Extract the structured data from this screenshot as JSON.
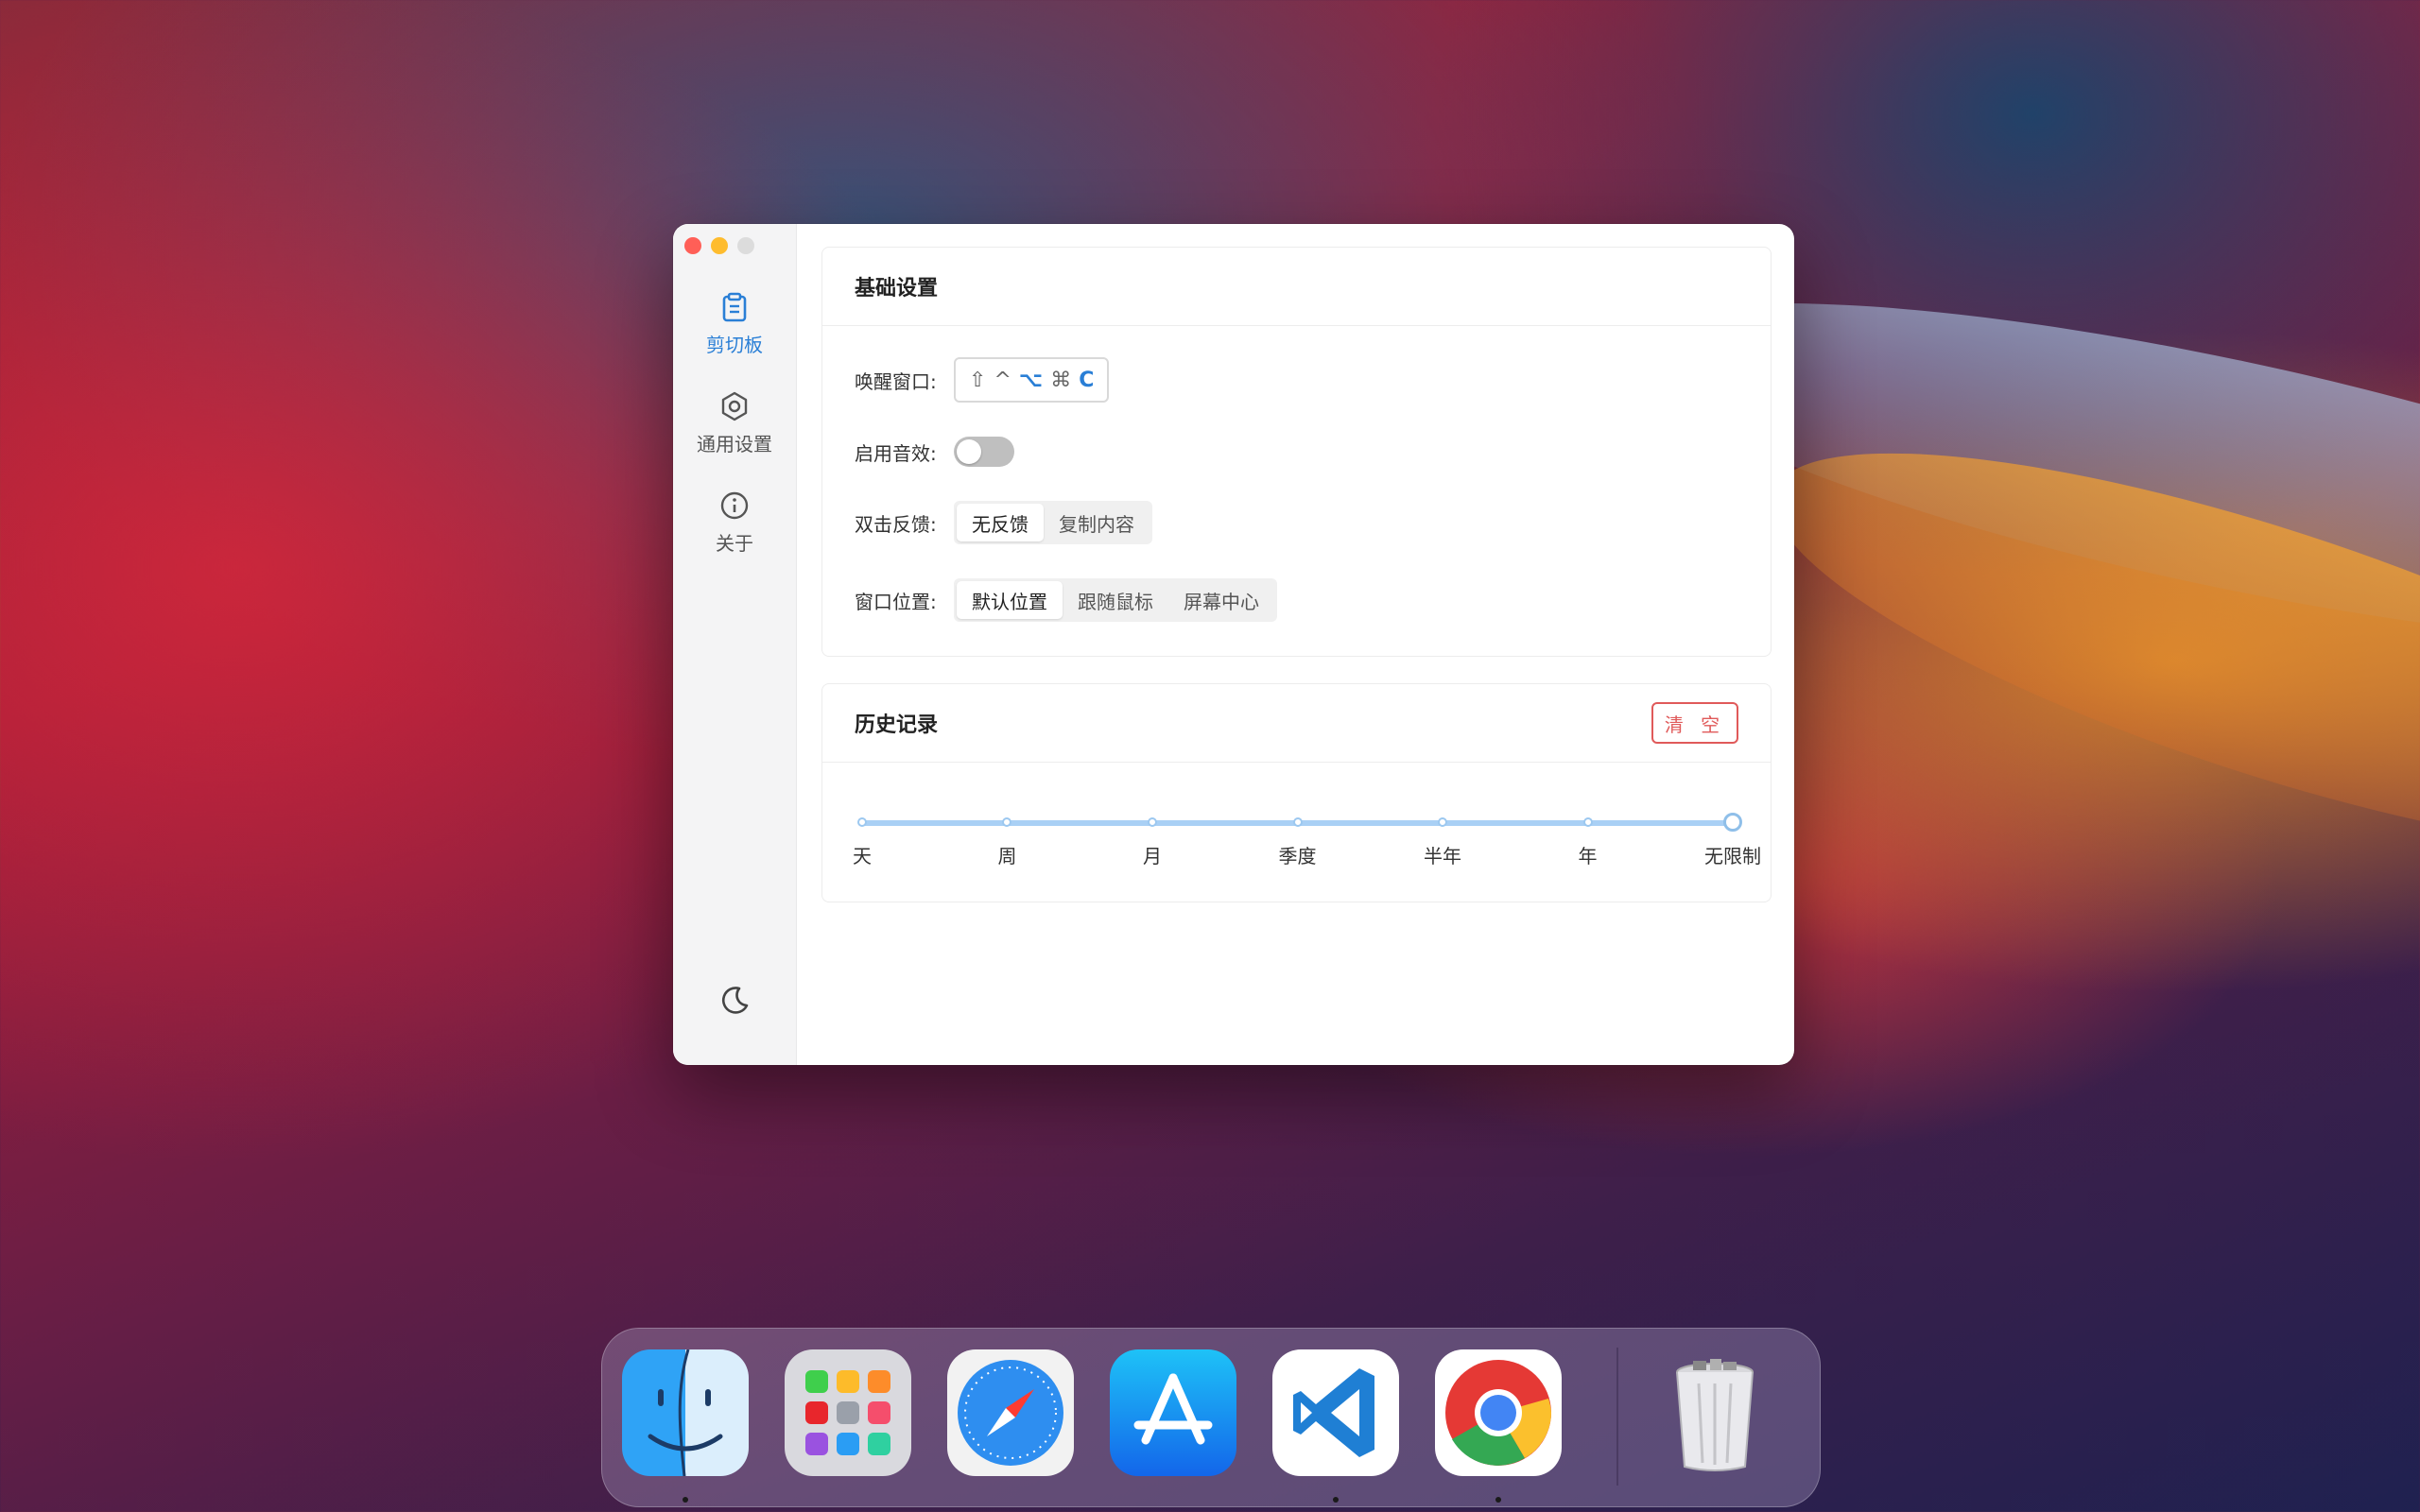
{
  "sidebar": {
    "items": [
      {
        "label": "剪切板",
        "icon": "clipboard-icon",
        "active": true
      },
      {
        "label": "通用设置",
        "icon": "hexagon-settings-icon",
        "active": false
      },
      {
        "label": "关于",
        "icon": "info-icon",
        "active": false
      }
    ],
    "theme_icon": "moon-icon"
  },
  "basic": {
    "title": "基础设置",
    "wake": {
      "label": "唤醒窗口:",
      "keys": [
        "⇧",
        "^",
        "⌥",
        "⌘"
      ],
      "key_last": "C"
    },
    "sound": {
      "label": "启用音效:",
      "enabled": false
    },
    "double_click": {
      "label": "双击反馈:",
      "options": [
        "无反馈",
        "复制内容"
      ],
      "selected": 0
    },
    "position": {
      "label": "窗口位置:",
      "options": [
        "默认位置",
        "跟随鼠标",
        "屏幕中心"
      ],
      "selected": 0
    }
  },
  "history": {
    "title": "历史记录",
    "clear_label": "清 空",
    "marks": [
      "天",
      "周",
      "月",
      "季度",
      "半年",
      "年",
      "无限制"
    ],
    "selected_index": 6
  },
  "dock": {
    "apps": [
      {
        "name": "Finder",
        "icon": "finder-icon",
        "running": true
      },
      {
        "name": "Launchpad",
        "icon": "launchpad-icon",
        "running": false
      },
      {
        "name": "Safari",
        "icon": "safari-icon",
        "running": false
      },
      {
        "name": "App Store",
        "icon": "app-store-icon",
        "running": false
      },
      {
        "name": "Visual Studio Code",
        "icon": "vscode-icon",
        "running": true
      },
      {
        "name": "Google Chrome",
        "icon": "chrome-icon",
        "running": true
      }
    ],
    "trash": {
      "name": "Trash",
      "icon": "trash-icon"
    }
  },
  "colors": {
    "accent": "#2a7fd6",
    "danger": "#e05a5a",
    "track": "#a9d0f5"
  }
}
